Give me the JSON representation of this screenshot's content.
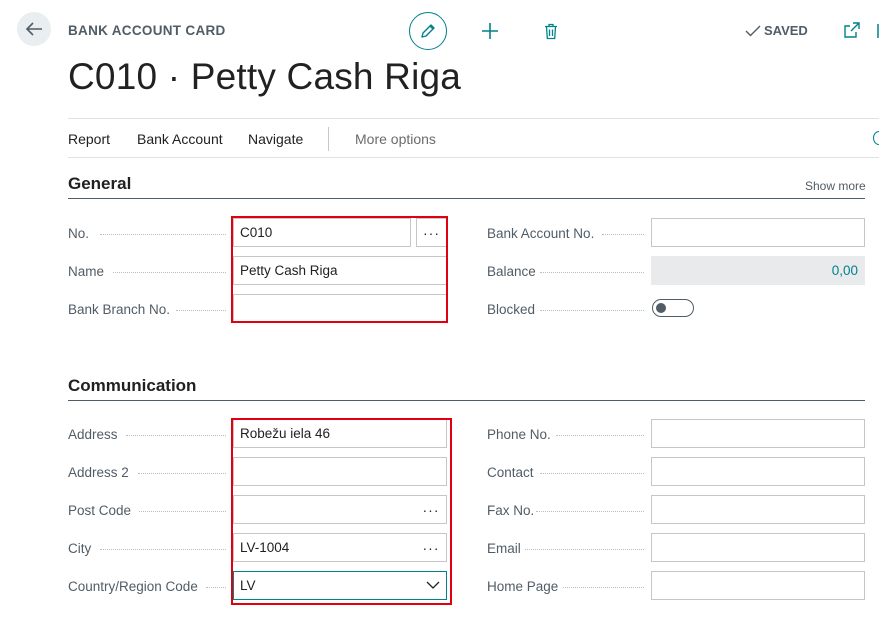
{
  "header": {
    "page_type": "BANK ACCOUNT CARD",
    "title": "C010 · Petty Cash Riga",
    "status": "SAVED"
  },
  "icons": {
    "back": "back-arrow-icon",
    "edit": "pencil-icon",
    "add": "plus-icon",
    "delete": "trash-icon",
    "saved": "check-icon",
    "popout": "popout-icon"
  },
  "actionbar": {
    "items": [
      "Report",
      "Bank Account",
      "Navigate"
    ],
    "more": "More options"
  },
  "general": {
    "title": "General",
    "show_more": "Show more",
    "no_label": "No.",
    "no_value": "C010",
    "name_label": "Name",
    "name_value": "Petty Cash Riga",
    "branch_label": "Bank Branch No.",
    "branch_value": "",
    "account_label": "Bank Account No.",
    "account_value": "",
    "balance_label": "Balance",
    "balance_value": "0,00",
    "blocked_label": "Blocked",
    "blocked_value": false
  },
  "communication": {
    "title": "Communication",
    "address_label": "Address",
    "address_value": "Robežu iela 46",
    "address2_label": "Address 2",
    "address2_value": "",
    "postcode_label": "Post Code",
    "postcode_value": "",
    "city_label": "City",
    "city_value": "LV-1004",
    "country_label": "Country/Region Code",
    "country_value": "LV",
    "phone_label": "Phone No.",
    "phone_value": "",
    "contact_label": "Contact",
    "contact_value": "",
    "fax_label": "Fax No.",
    "fax_value": "",
    "email_label": "Email",
    "email_value": "",
    "homepage_label": "Home Page",
    "homepage_value": ""
  },
  "colors": {
    "accent": "#00818c",
    "highlight": "#e0000f",
    "label": "#505c66"
  }
}
